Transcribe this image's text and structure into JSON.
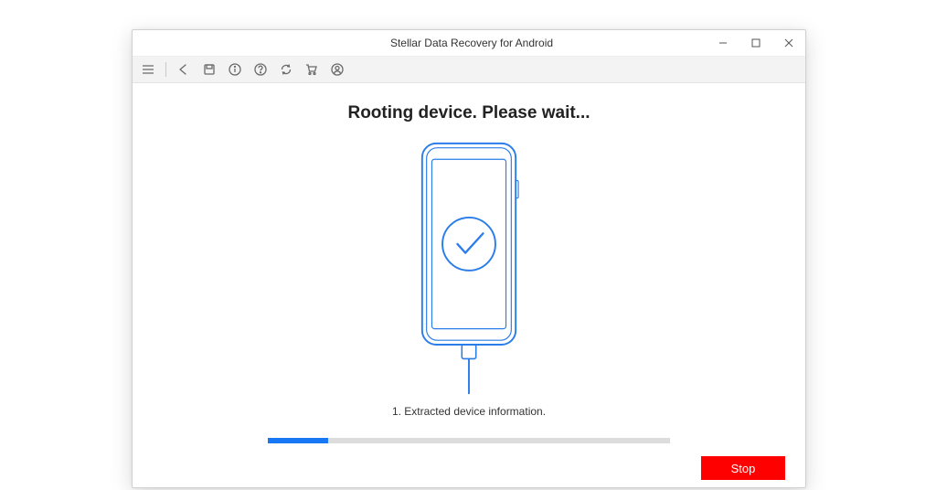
{
  "window": {
    "title": "Stellar Data Recovery for Android"
  },
  "heading": "Rooting device. Please wait...",
  "status": "1. Extracted device information.",
  "progress": {
    "percent": 15
  },
  "buttons": {
    "stop": "Stop"
  },
  "colors": {
    "accent": "#1877f2",
    "danger": "#ff0000"
  }
}
